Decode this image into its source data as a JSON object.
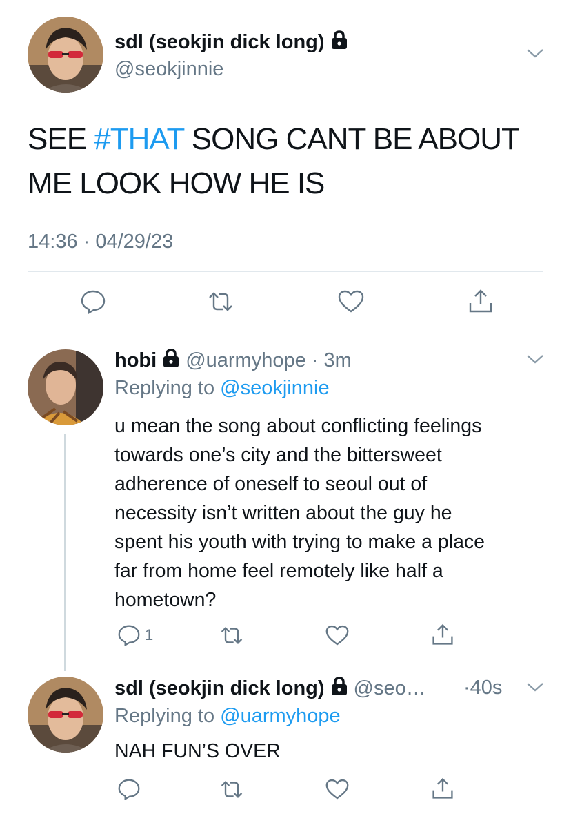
{
  "main_tweet": {
    "display_name": "sdl (seokjin dick long)",
    "handle": "@seokjinnie",
    "text_before_tag": "SEE ",
    "hashtag": "#THAT",
    "text_after_tag": " SONG CANT BE ABOUT",
    "text_line2": "ME LOOK HOW HE IS",
    "timestamp": "14:36 · 04/29/23",
    "actions": [
      "reply-icon",
      "retweet-icon",
      "like-icon",
      "share-icon"
    ]
  },
  "reply1": {
    "display_name": "hobi",
    "handle": "@uarmyhope",
    "time": "· 3m",
    "replying_to_label": "Replying to ",
    "replying_to_handle": "@seokjinnie",
    "lines": [
      "u mean the song about conflicting feelings",
      "towards one’s city and the bittersweet",
      "adherence of oneself to seoul out of",
      "necessity isn’t written about the guy he",
      "spent his youth with trying to make a place",
      "far from home feel remotely like half a",
      "hometown?"
    ],
    "reply_count": "1"
  },
  "reply2": {
    "display_name": "sdl (seokjin dick long)",
    "handle": "@seo…",
    "time": "·40s",
    "replying_to_label": "Replying to ",
    "replying_to_handle": "@uarmyhope",
    "text": "NAH FUN’S OVER"
  },
  "colors": {
    "link": "#1d9bf0",
    "secondary_text": "#657786",
    "divider": "#e1e8ed"
  }
}
